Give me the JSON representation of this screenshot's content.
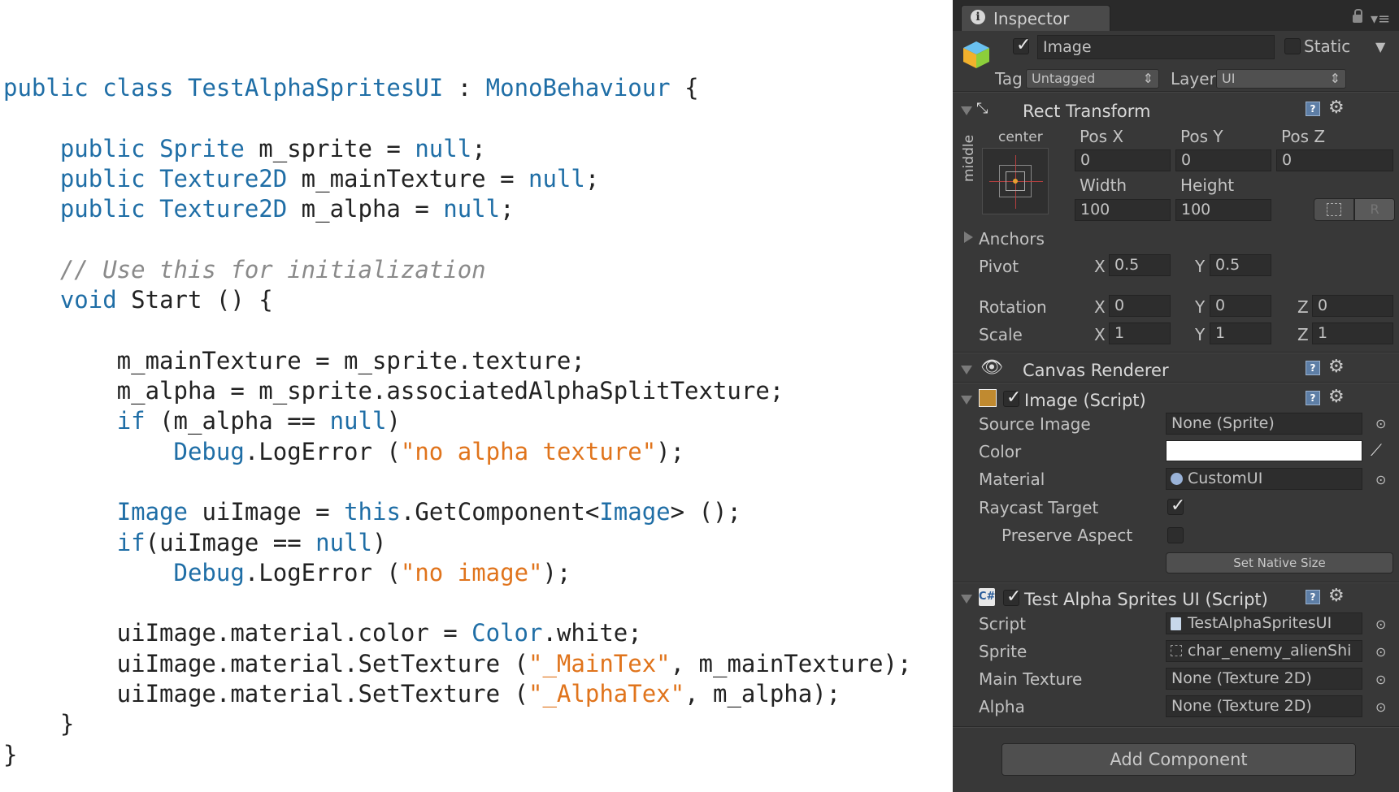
{
  "code": {
    "lines": [
      {
        "parts": [
          {
            "t": "kw",
            "v": "public class "
          },
          {
            "t": "ty",
            "v": "TestAlphaSpritesUI"
          },
          {
            "t": "pl",
            "v": " : "
          },
          {
            "t": "ty",
            "v": "MonoBehaviour"
          },
          {
            "t": "pl",
            "v": " {"
          }
        ]
      },
      {
        "parts": []
      },
      {
        "parts": [
          {
            "t": "pl",
            "v": "    "
          },
          {
            "t": "kw",
            "v": "public "
          },
          {
            "t": "ty",
            "v": "Sprite"
          },
          {
            "t": "pl",
            "v": " m_sprite = "
          },
          {
            "t": "kw",
            "v": "null"
          },
          {
            "t": "pl",
            "v": ";"
          }
        ]
      },
      {
        "parts": [
          {
            "t": "pl",
            "v": "    "
          },
          {
            "t": "kw",
            "v": "public "
          },
          {
            "t": "ty",
            "v": "Texture2D"
          },
          {
            "t": "pl",
            "v": " m_mainTexture = "
          },
          {
            "t": "kw",
            "v": "null"
          },
          {
            "t": "pl",
            "v": ";"
          }
        ]
      },
      {
        "parts": [
          {
            "t": "pl",
            "v": "    "
          },
          {
            "t": "kw",
            "v": "public "
          },
          {
            "t": "ty",
            "v": "Texture2D"
          },
          {
            "t": "pl",
            "v": " m_alpha = "
          },
          {
            "t": "kw",
            "v": "null"
          },
          {
            "t": "pl",
            "v": ";"
          }
        ]
      },
      {
        "parts": []
      },
      {
        "parts": [
          {
            "t": "pl",
            "v": "    "
          },
          {
            "t": "cm",
            "v": "// Use this for initialization"
          }
        ]
      },
      {
        "parts": [
          {
            "t": "pl",
            "v": "    "
          },
          {
            "t": "kw",
            "v": "void"
          },
          {
            "t": "pl",
            "v": " Start () {"
          }
        ]
      },
      {
        "parts": []
      },
      {
        "parts": [
          {
            "t": "pl",
            "v": "        m_mainTexture = m_sprite.texture;"
          }
        ]
      },
      {
        "parts": [
          {
            "t": "pl",
            "v": "        m_alpha = m_sprite.associatedAlphaSplitTexture;"
          }
        ]
      },
      {
        "parts": [
          {
            "t": "pl",
            "v": "        "
          },
          {
            "t": "kw",
            "v": "if"
          },
          {
            "t": "pl",
            "v": " (m_alpha == "
          },
          {
            "t": "kw",
            "v": "null"
          },
          {
            "t": "pl",
            "v": ")"
          }
        ]
      },
      {
        "parts": [
          {
            "t": "pl",
            "v": "            "
          },
          {
            "t": "ty",
            "v": "Debug"
          },
          {
            "t": "pl",
            "v": ".LogError ("
          },
          {
            "t": "st",
            "v": "\"no alpha texture\""
          },
          {
            "t": "pl",
            "v": ");"
          }
        ]
      },
      {
        "parts": []
      },
      {
        "parts": [
          {
            "t": "pl",
            "v": "        "
          },
          {
            "t": "ty",
            "v": "Image"
          },
          {
            "t": "pl",
            "v": " uiImage = "
          },
          {
            "t": "kw",
            "v": "this"
          },
          {
            "t": "pl",
            "v": ".GetComponent<"
          },
          {
            "t": "ty",
            "v": "Image"
          },
          {
            "t": "pl",
            "v": "> ();"
          }
        ]
      },
      {
        "parts": [
          {
            "t": "pl",
            "v": "        "
          },
          {
            "t": "kw",
            "v": "if"
          },
          {
            "t": "pl",
            "v": "(uiImage == "
          },
          {
            "t": "kw",
            "v": "null"
          },
          {
            "t": "pl",
            "v": ")"
          }
        ]
      },
      {
        "parts": [
          {
            "t": "pl",
            "v": "            "
          },
          {
            "t": "ty",
            "v": "Debug"
          },
          {
            "t": "pl",
            "v": ".LogError ("
          },
          {
            "t": "st",
            "v": "\"no image\""
          },
          {
            "t": "pl",
            "v": ");"
          }
        ]
      },
      {
        "parts": []
      },
      {
        "parts": [
          {
            "t": "pl",
            "v": "        uiImage.material.color = "
          },
          {
            "t": "ty",
            "v": "Color"
          },
          {
            "t": "pl",
            "v": ".white;"
          }
        ]
      },
      {
        "parts": [
          {
            "t": "pl",
            "v": "        uiImage.material.SetTexture ("
          },
          {
            "t": "st",
            "v": "\"_MainTex\""
          },
          {
            "t": "pl",
            "v": ", m_mainTexture);"
          }
        ]
      },
      {
        "parts": [
          {
            "t": "pl",
            "v": "        uiImage.material.SetTexture ("
          },
          {
            "t": "st",
            "v": "\"_AlphaTex\""
          },
          {
            "t": "pl",
            "v": ", m_alpha);"
          }
        ]
      },
      {
        "parts": [
          {
            "t": "pl",
            "v": "    }"
          }
        ]
      },
      {
        "parts": [
          {
            "t": "pl",
            "v": "}"
          }
        ]
      }
    ]
  },
  "inspector": {
    "tab_label": "Inspector",
    "object": {
      "name": "Image",
      "static_label": "Static",
      "tag_label": "Tag",
      "tag_value": "Untagged",
      "layer_label": "Layer",
      "layer_value": "UI"
    },
    "rect_transform": {
      "title": "Rect Transform",
      "anchor_h": "center",
      "anchor_v": "middle",
      "pos_x_label": "Pos X",
      "pos_y_label": "Pos Y",
      "pos_z_label": "Pos Z",
      "pos_x": "0",
      "pos_y": "0",
      "pos_z": "0",
      "width_label": "Width",
      "height_label": "Height",
      "width": "100",
      "height": "100",
      "r_button": "R",
      "anchors_label": "Anchors",
      "pivot_label": "Pivot",
      "pivot_x": "0.5",
      "pivot_y": "0.5",
      "rotation_label": "Rotation",
      "rot_x": "0",
      "rot_y": "0",
      "rot_z": "0",
      "scale_label": "Scale",
      "scale_x": "1",
      "scale_y": "1",
      "scale_z": "1",
      "x_label": "X",
      "y_label": "Y",
      "z_label": "Z"
    },
    "canvas_renderer": {
      "title": "Canvas Renderer"
    },
    "image_script": {
      "title": "Image (Script)",
      "source_image_label": "Source Image",
      "source_image": "None (Sprite)",
      "color_label": "Color",
      "color_value": "#ffffff",
      "material_label": "Material",
      "material": "CustomUI",
      "raycast_label": "Raycast Target",
      "raycast_checked": true,
      "preserve_label": "Preserve Aspect",
      "preserve_checked": false,
      "native_size_button": "Set Native Size"
    },
    "test_script": {
      "title": "Test Alpha Sprites UI (Script)",
      "script_label": "Script",
      "script": "TestAlphaSpritesUI",
      "sprite_label": "Sprite",
      "sprite": "char_enemy_alienShi",
      "main_texture_label": "Main Texture",
      "main_texture": "None (Texture 2D)",
      "alpha_label": "Alpha",
      "alpha": "None (Texture 2D)"
    },
    "add_component_button": "Add Component"
  },
  "colors": {
    "keyword": "#1f6ea6",
    "string": "#e0741c",
    "comment": "#8a8a8a",
    "inspector_bg": "#383838"
  }
}
